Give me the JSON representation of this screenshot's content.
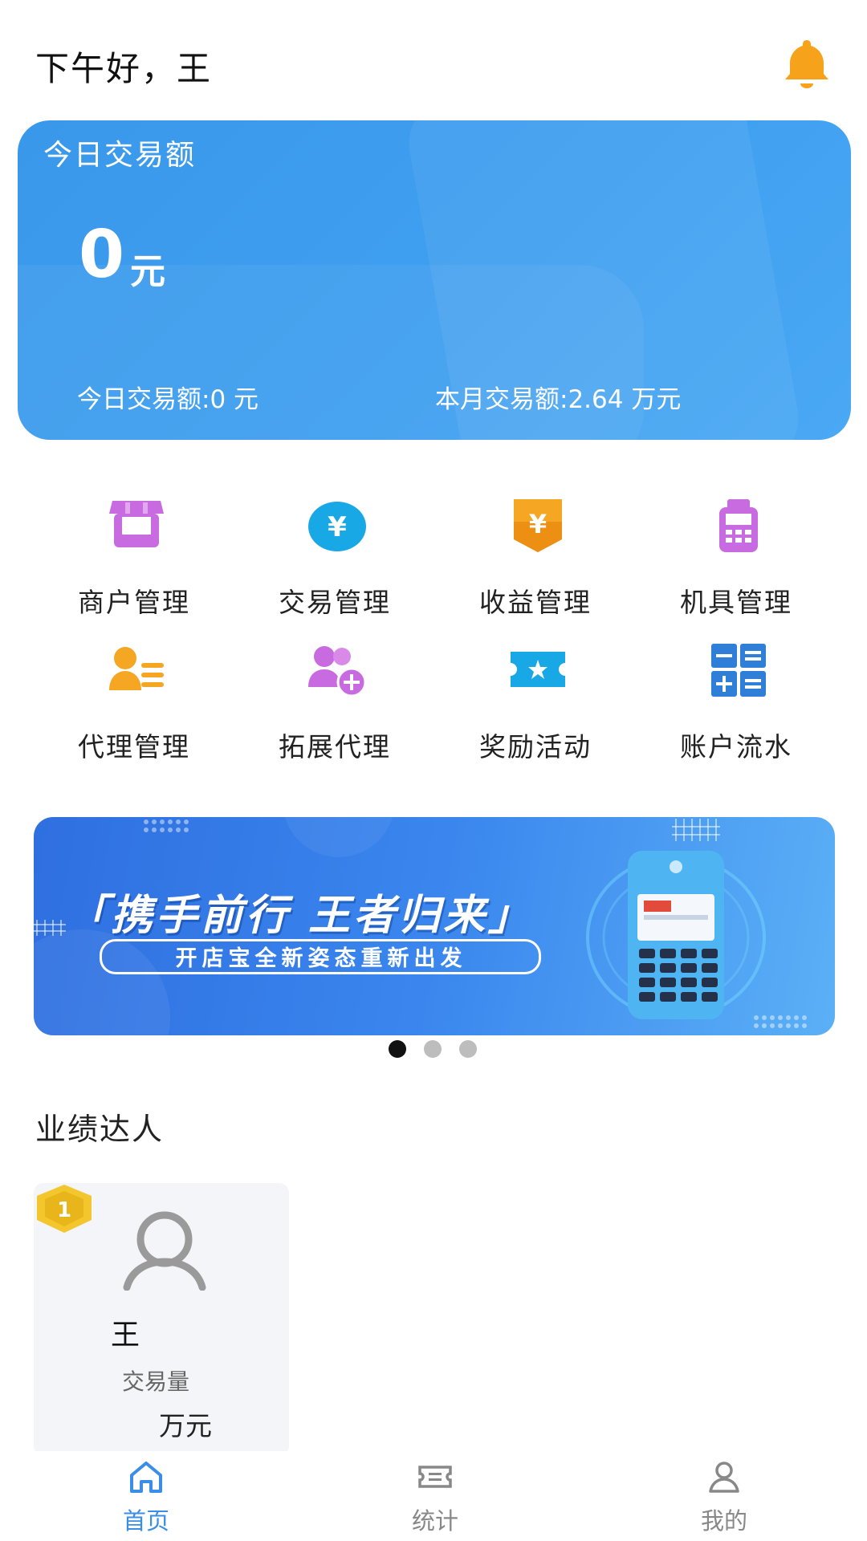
{
  "header": {
    "greeting": "下午好，王"
  },
  "card": {
    "title": "今日交易额",
    "amount": "0",
    "amount_unit": "元",
    "today_stat": "今日交易额:0 元",
    "month_stat": "本月交易额:2.64 万元"
  },
  "menu": [
    {
      "label": "商户管理",
      "icon": "store-icon"
    },
    {
      "label": "交易管理",
      "icon": "yuan-circle-icon"
    },
    {
      "label": "收益管理",
      "icon": "yuan-tag-icon"
    },
    {
      "label": "机具管理",
      "icon": "pos-terminal-icon"
    },
    {
      "label": "代理管理",
      "icon": "agents-icon"
    },
    {
      "label": "拓展代理",
      "icon": "add-agent-icon"
    },
    {
      "label": "奖励活动",
      "icon": "reward-ticket-icon"
    },
    {
      "label": "账户流水",
      "icon": "calculator-icon"
    }
  ],
  "banner": {
    "title": "「携手前行 王者归来」",
    "subtitle": "开店宝全新姿态重新出发",
    "slide_count": 3,
    "active_slide": 0
  },
  "ranking": {
    "section_title": "业绩达人",
    "items": [
      {
        "rank": "1",
        "name": "王",
        "volume_label": "交易量",
        "volume": "万元"
      }
    ]
  },
  "tabbar": {
    "items": [
      {
        "label": "首页",
        "icon": "home-icon",
        "active": true
      },
      {
        "label": "统计",
        "icon": "stats-ticket-icon",
        "active": false
      },
      {
        "label": "我的",
        "icon": "profile-icon",
        "active": false
      }
    ]
  },
  "colors": {
    "accent": "#3a8ee8",
    "card_bg": "#3f9ff0",
    "icon_purple": "#c86be0",
    "icon_cyan": "#19a8e6",
    "icon_orange": "#f5a623",
    "bell_orange": "#f7a21b",
    "badge_yellow": "#f2c62c"
  }
}
